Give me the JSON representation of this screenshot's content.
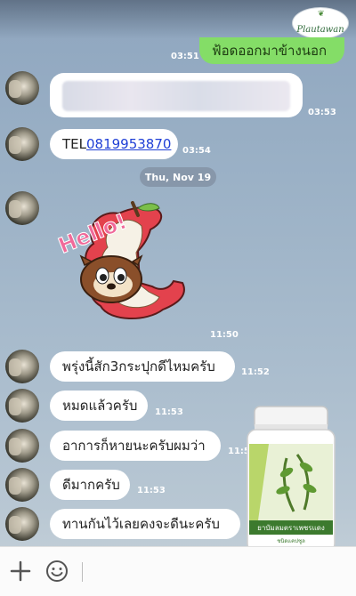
{
  "header": {
    "logo_text": "Plautawan"
  },
  "messages": [
    {
      "id": "m0",
      "side": "right",
      "text": "ฟ้อดออกมาข้างนอก",
      "time": "03:51"
    },
    {
      "id": "m1",
      "side": "left",
      "text": "",
      "blurred": true,
      "time": "03:53"
    },
    {
      "id": "m2",
      "side": "left",
      "prefix": "TEL",
      "link": "0819953870",
      "time": "03:54"
    },
    {
      "id": "m3",
      "side": "left",
      "type": "sticker",
      "sticker_text": "Hello!",
      "time": "11:50"
    },
    {
      "id": "m4",
      "side": "left",
      "text": "พรุ่งนี้สัก3กระปุกดีไหมครับ",
      "time": "11:52"
    },
    {
      "id": "m5",
      "side": "left",
      "text": "หมดแล้วครับ",
      "time": "11:53"
    },
    {
      "id": "m6",
      "side": "left",
      "text": "อาการก็หายนะครับผมว่า",
      "time": "11:53"
    },
    {
      "id": "m7",
      "side": "left",
      "text": "ดีมากครับ",
      "time": "11:53"
    },
    {
      "id": "m8",
      "side": "left",
      "text": "ทานกันไว้เลยคงจะดีนะครับ",
      "time": ""
    }
  ],
  "date_separator": "Thu, Nov 19",
  "product": {
    "label_line1": "ยาบัมลมตราเพชรแดง",
    "label_line2": "ชนิดแคปซูล"
  },
  "input_bar": {
    "plus_icon": "plus-icon",
    "emoji_icon": "emoji-icon"
  },
  "colors": {
    "sent_bubble": "#84dd67",
    "received_bubble": "#ffffff",
    "link": "#1f3fd6",
    "date_pill": "#8797aa"
  }
}
